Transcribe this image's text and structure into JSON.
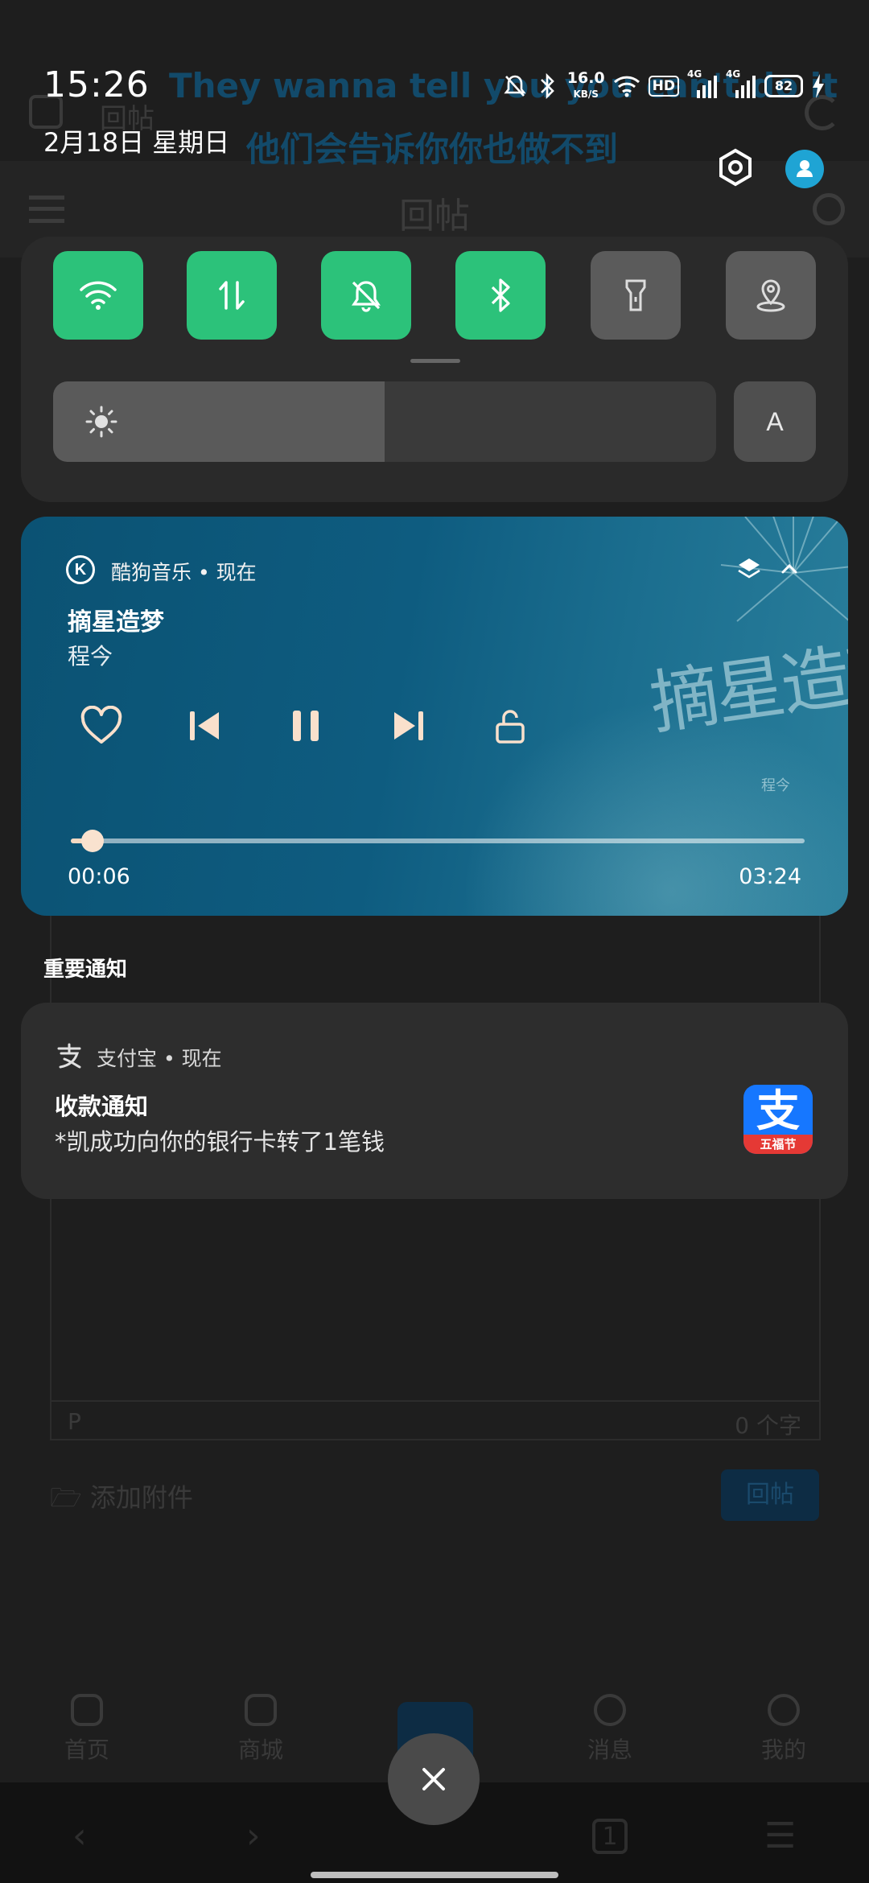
{
  "status_bar": {
    "time": "15:26",
    "date": "2月18日  星期日",
    "net_speed_value": "16.0",
    "net_speed_unit": "KB/S",
    "hd_label": "HD",
    "sim1_label": "4G",
    "sim2_label": "4G",
    "battery": "82",
    "icons": [
      "mute-icon",
      "bluetooth-icon",
      "wifi-icon",
      "signal-icon",
      "charging-icon"
    ]
  },
  "lyrics": {
    "line_en": "They wanna tell you you can't do it",
    "line_cn": "他们会告诉你你也做不到"
  },
  "quick_settings": {
    "tiles": [
      {
        "name": "wifi",
        "state": "on"
      },
      {
        "name": "mobile-data",
        "state": "on"
      },
      {
        "name": "silent",
        "state": "on"
      },
      {
        "name": "bluetooth",
        "state": "on"
      },
      {
        "name": "flashlight",
        "state": "off"
      },
      {
        "name": "location",
        "state": "off"
      }
    ],
    "brightness": 0.5,
    "auto_brightness_label": "A",
    "accent_on": "#2cc27a",
    "tile_off": "#5b5b5b"
  },
  "media": {
    "app_badge": "K",
    "app_line": "酷狗音乐 • 现在",
    "song_title": "摘星造梦",
    "artist": "程今",
    "artwork_title": "摘星造梦",
    "artwork_artist": "程今",
    "current_time": "00:06",
    "total_time": "03:24",
    "progress": 0.03,
    "controls": [
      "heart-icon",
      "previous-icon",
      "pause-icon",
      "next-icon",
      "unlock-icon"
    ]
  },
  "important_section": {
    "label": "重要通知"
  },
  "notification": {
    "app_line": "支付宝 • 现在",
    "title": "收款通知",
    "body": "*凯成功向你的银行卡转了1笔钱",
    "logo_char": "支",
    "logo_band": "五福节"
  },
  "background_app": {
    "page_title": "回帖",
    "top_label": "回帖",
    "editor_placeholder": "P",
    "char_count": "0 个字",
    "attach_label": "添加附件",
    "reply_button": "回帖",
    "tabs": [
      "首页",
      "商城",
      "",
      "消息",
      "我的"
    ]
  }
}
